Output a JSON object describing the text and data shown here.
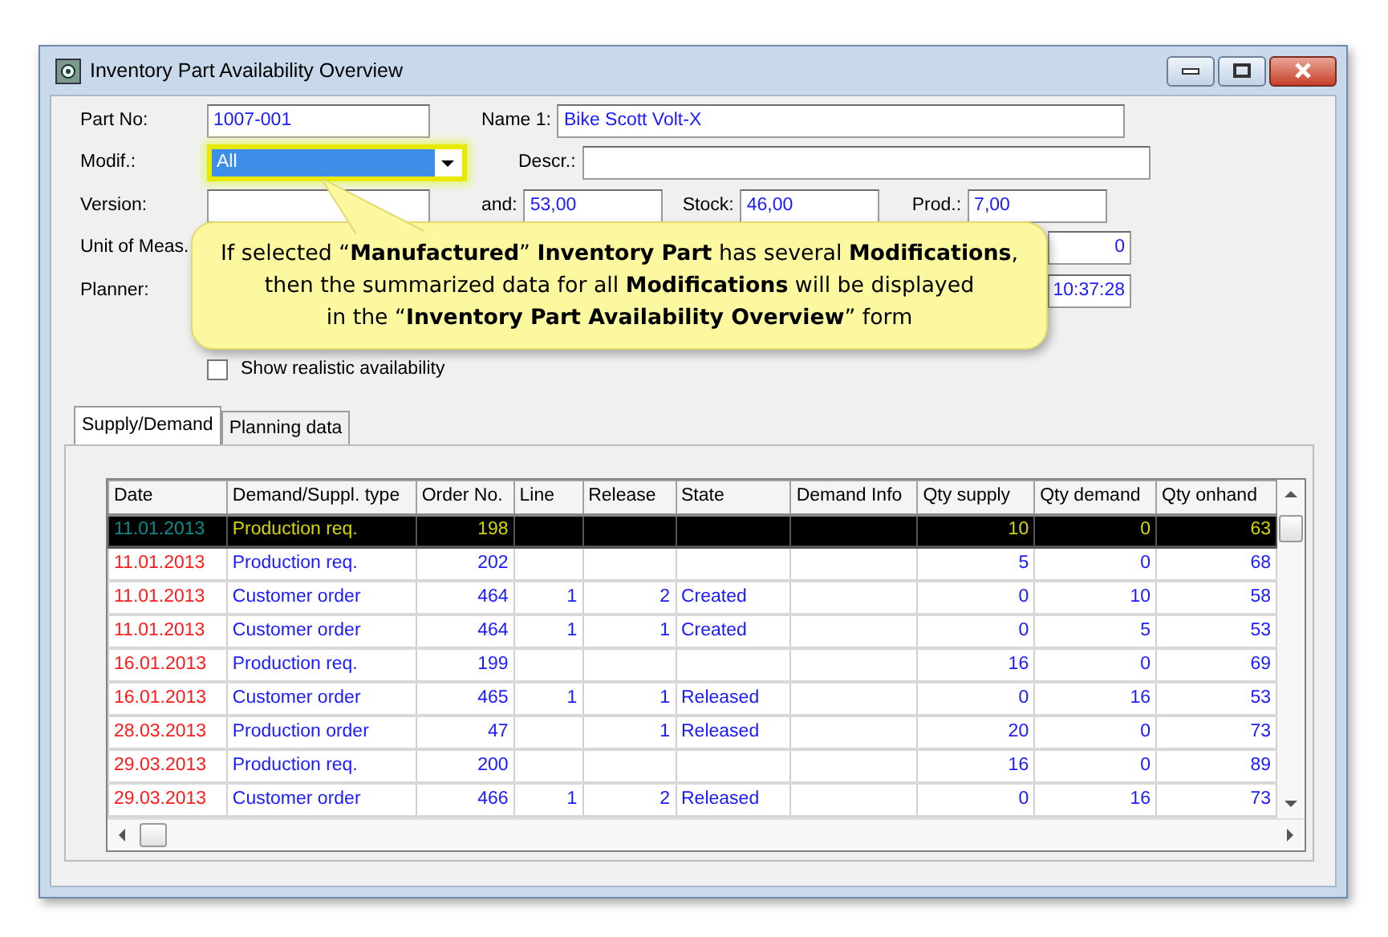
{
  "window": {
    "title": "Inventory Part Availability Overview"
  },
  "form": {
    "rows": [
      {
        "left": {
          "label": "Part No:",
          "value": "1007-001",
          "kind": "text"
        },
        "right": [
          {
            "label": "Name 1:",
            "value": "Bike Scott Volt-X",
            "kind": "wide"
          }
        ]
      },
      {
        "left": {
          "label": "Modif.:",
          "value": "All",
          "kind": "combo",
          "highlighted": true
        },
        "right": [
          {
            "label": "Descr.:",
            "kind": "wide"
          }
        ]
      },
      {
        "left": {
          "label": "Version:",
          "kind": "text"
        },
        "right": [
          {
            "label": "and:",
            "value": "53,00",
            "kind": "small"
          },
          {
            "label": "Stock:",
            "value": "46,00",
            "kind": "small"
          },
          {
            "label": "Prod.:",
            "value": "7,00",
            "kind": "small"
          }
        ]
      },
      {
        "left": {
          "label": "Unit of Meas.",
          "kind": "hidden"
        },
        "right": [
          {
            "value": "0",
            "kind": "tail"
          }
        ]
      },
      {
        "left": {
          "label": "Planner:",
          "kind": "hidden"
        },
        "right": [
          {
            "value": "10:37:28",
            "kind": "tail"
          }
        ]
      }
    ],
    "checkbox": {
      "label": "Show realistic availability",
      "checked": false
    }
  },
  "callout": {
    "text": "If selected “**Manufactured**” **Inventory Part** has several **Modifications**,\nthen the summarized data for all **Modifications** will be displayed\nin the “**Inventory Part Availability Overview**” form"
  },
  "tabs": [
    {
      "label": "Supply/Demand",
      "selected": true
    },
    {
      "label": "Planning data",
      "selected": false
    }
  ],
  "table": {
    "columns": [
      "Date",
      "Demand/Suppl. type",
      "Order No.",
      "Line",
      "Release",
      "State",
      "Demand Info",
      "Qty supply",
      "Qty demand",
      "Qty onhand"
    ],
    "rows": [
      {
        "selected": true,
        "cells": [
          "11.01.2013",
          "Production req.",
          "198",
          "",
          "",
          "",
          "",
          "10",
          "0",
          "63"
        ]
      },
      {
        "selected": false,
        "cells": [
          "11.01.2013",
          "Production req.",
          "202",
          "",
          "",
          "",
          "",
          "5",
          "0",
          "68"
        ]
      },
      {
        "selected": false,
        "cells": [
          "11.01.2013",
          "Customer order",
          "464",
          "1",
          "2",
          "Created",
          "",
          "0",
          "10",
          "58"
        ]
      },
      {
        "selected": false,
        "cells": [
          "11.01.2013",
          "Customer order",
          "464",
          "1",
          "1",
          "Created",
          "",
          "0",
          "5",
          "53"
        ]
      },
      {
        "selected": false,
        "cells": [
          "16.01.2013",
          "Production req.",
          "199",
          "",
          "",
          "",
          "",
          "16",
          "0",
          "69"
        ]
      },
      {
        "selected": false,
        "cells": [
          "16.01.2013",
          "Customer order",
          "465",
          "1",
          "1",
          "Released",
          "",
          "0",
          "16",
          "53"
        ]
      },
      {
        "selected": false,
        "cells": [
          "28.03.2013",
          "Production order",
          "47",
          "",
          "1",
          "Released",
          "",
          "20",
          "0",
          "73"
        ]
      },
      {
        "selected": false,
        "cells": [
          "29.03.2013",
          "Production req.",
          "200",
          "",
          "",
          "",
          "",
          "16",
          "0",
          "89"
        ]
      },
      {
        "selected": false,
        "cells": [
          "29.03.2013",
          "Customer order",
          "466",
          "1",
          "2",
          "Released",
          "",
          "0",
          "16",
          "73"
        ]
      }
    ]
  }
}
